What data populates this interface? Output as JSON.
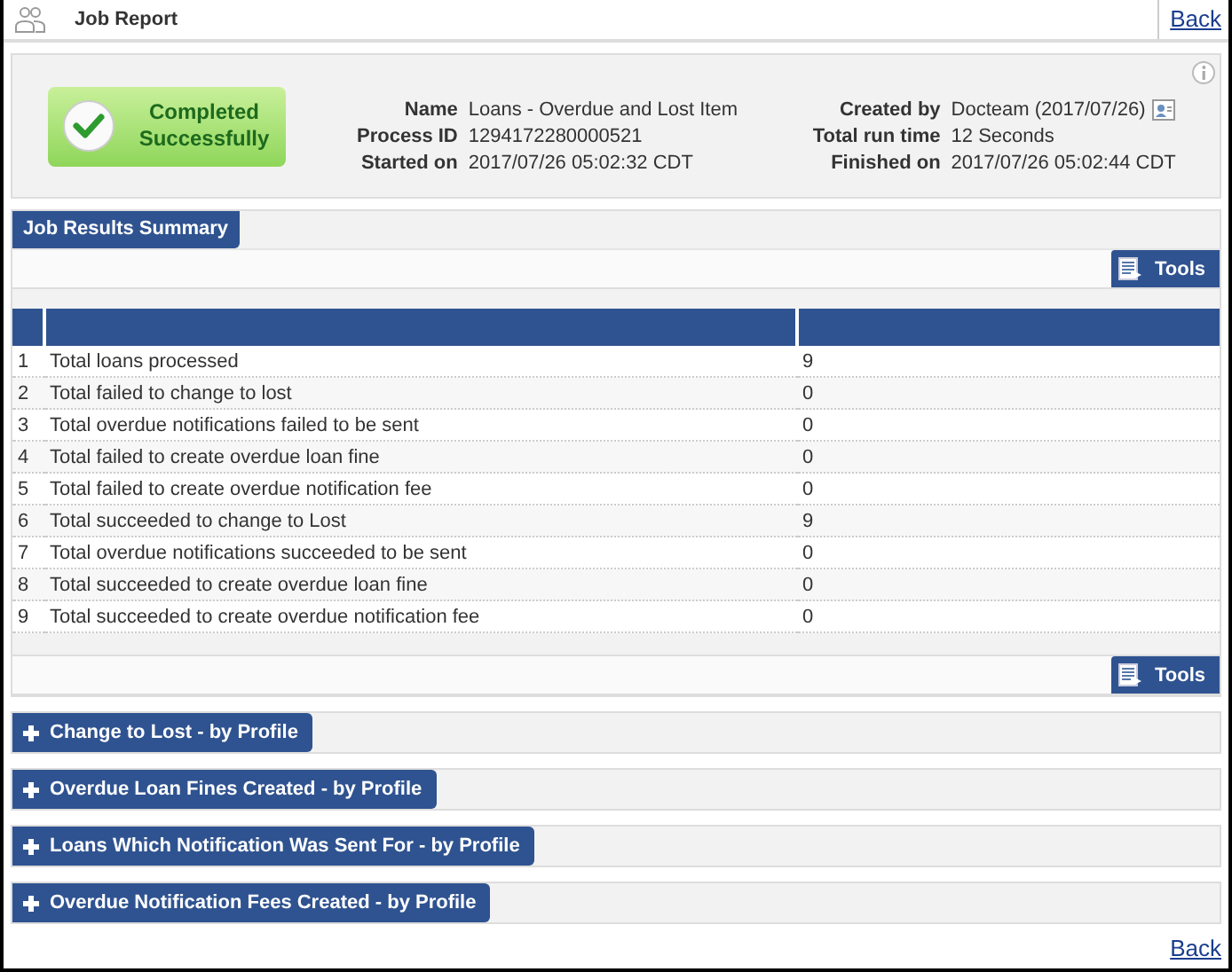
{
  "header": {
    "title": "Job Report",
    "back_link": "Back"
  },
  "status": {
    "text": "Completed Successfully",
    "success": true
  },
  "details": [
    {
      "label": "Name",
      "value": "Loans - Overdue and Lost Item"
    },
    {
      "label": "Created by",
      "value": "Docteam (2017/07/26)",
      "kind": "user"
    },
    {
      "label": "Process ID",
      "value": "1294172280000521"
    },
    {
      "label": "Total run time",
      "value": "12 Seconds"
    },
    {
      "label": "Started on",
      "value": "2017/07/26 05:02:32 CDT"
    },
    {
      "label": "Finished on",
      "value": "2017/07/26 05:02:44 CDT"
    }
  ],
  "summary": {
    "title": "Job Results Summary",
    "tools_top": "Tools",
    "tools_bottom": "Tools",
    "rows": [
      {
        "index": "1",
        "label": "Total loans processed",
        "value": "9"
      },
      {
        "index": "2",
        "label": "Total failed to change to lost",
        "value": "0"
      },
      {
        "index": "3",
        "label": "Total overdue notifications failed to be sent",
        "value": "0"
      },
      {
        "index": "4",
        "label": "Total failed to create overdue loan fine",
        "value": "0"
      },
      {
        "index": "5",
        "label": "Total failed to create overdue notification fee",
        "value": "0"
      },
      {
        "index": "6",
        "label": "Total succeeded to change to Lost",
        "value": "9"
      },
      {
        "index": "7",
        "label": "Total overdue notifications succeeded to be sent",
        "value": "0"
      },
      {
        "index": "8",
        "label": "Total succeeded to create overdue loan fine",
        "value": "0"
      },
      {
        "index": "9",
        "label": "Total succeeded to create overdue notification fee",
        "value": "0"
      }
    ]
  },
  "sections": [
    {
      "title": "Change to Lost - by Profile",
      "expanded": false
    },
    {
      "title": "Overdue Loan Fines Created - by Profile",
      "expanded": false
    },
    {
      "title": "Loans Which Notification Was Sent For - by Profile",
      "expanded": false
    },
    {
      "title": "Overdue Notification Fees Created - by Profile",
      "expanded": false
    }
  ],
  "footer": {
    "back_link": "Back"
  }
}
